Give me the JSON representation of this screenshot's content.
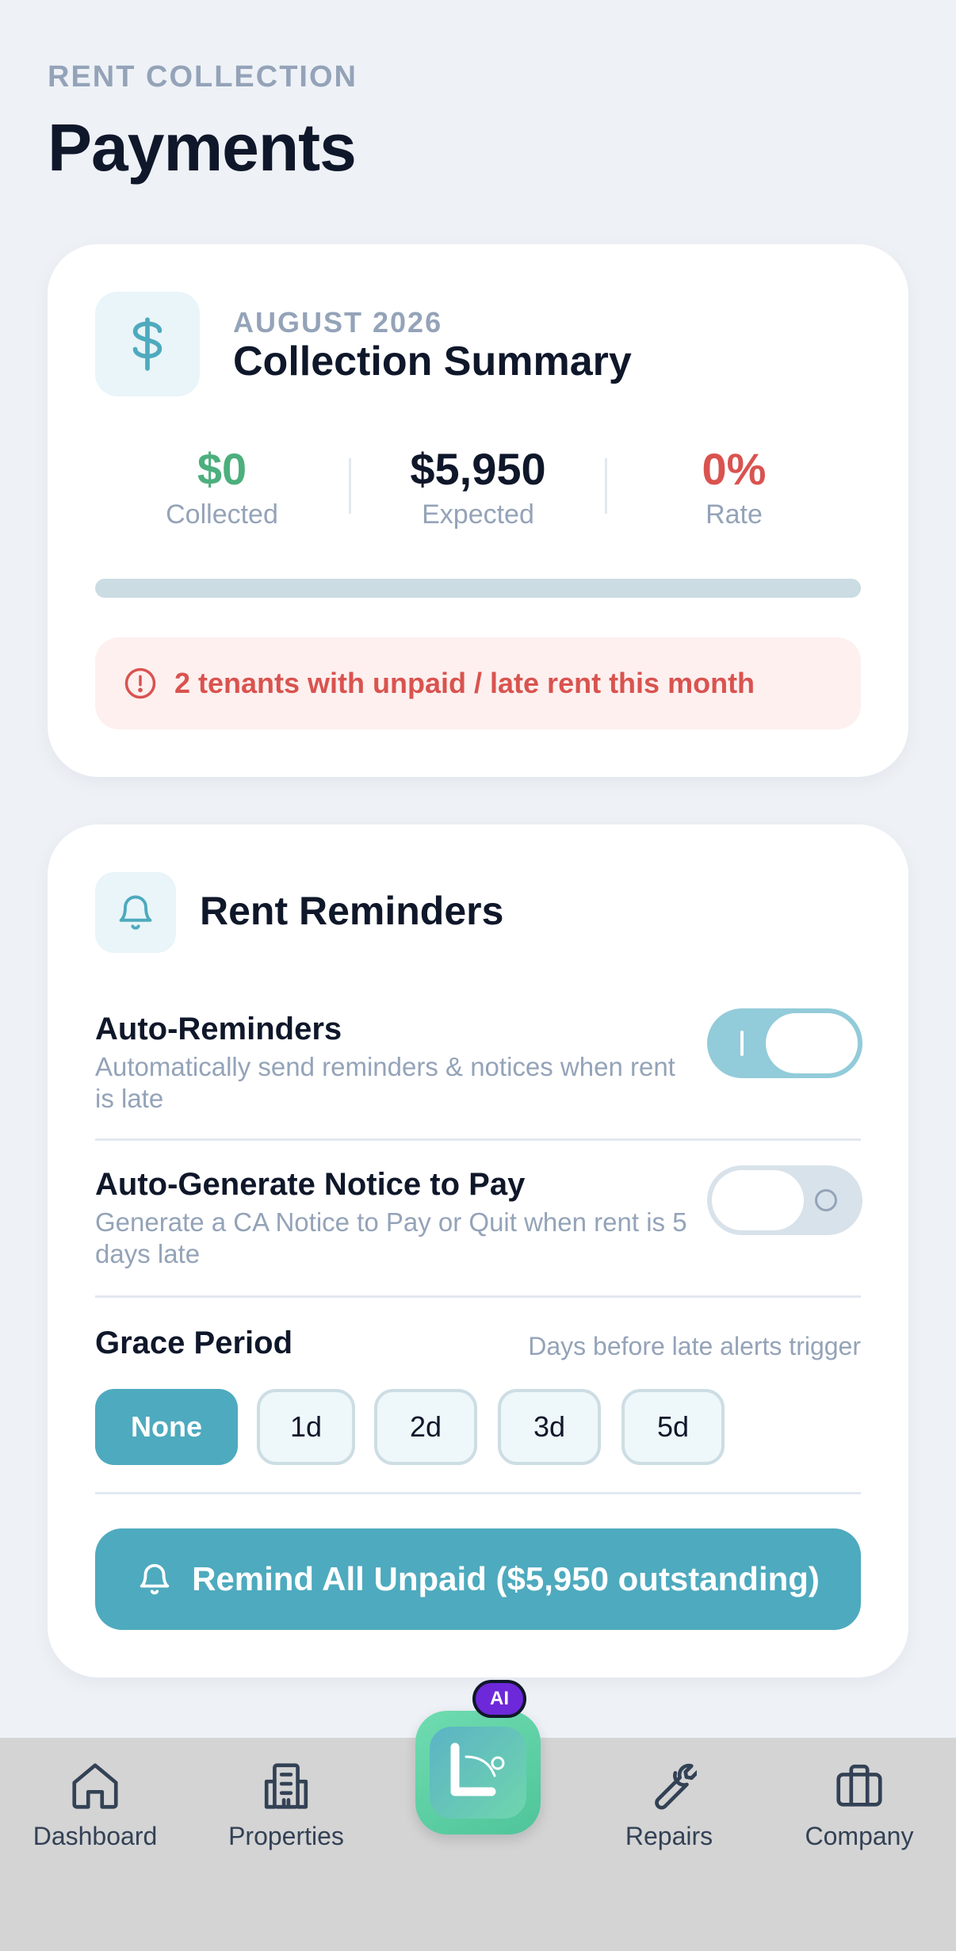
{
  "header": {
    "eyebrow": "RENT COLLECTION",
    "title": "Payments"
  },
  "summary": {
    "icon": "dollar-icon",
    "period": "AUGUST 2026",
    "title": "Collection Summary",
    "stats": [
      {
        "value": "$0",
        "label": "Collected",
        "color": "#4caf7d"
      },
      {
        "value": "$5,950",
        "label": "Expected",
        "color": "#0f172a"
      },
      {
        "value": "0%",
        "label": "Rate",
        "color": "#d9534f"
      }
    ],
    "collection_progress_percent": 0,
    "alert": {
      "icon": "alert-circle-icon",
      "text": "2 tenants with unpaid / late rent this month"
    }
  },
  "reminders": {
    "icon": "bell-icon",
    "title": "Rent Reminders",
    "auto_reminders": {
      "title": "Auto-Reminders",
      "description": "Automatically send reminders & notices when rent is late",
      "enabled": true
    },
    "auto_notice": {
      "title": "Auto-Generate Notice to Pay",
      "description": "Generate a CA Notice to Pay or Quit when rent is 5 days late",
      "enabled": false
    },
    "grace_period": {
      "title": "Grace Period",
      "hint": "Days before late alerts trigger",
      "options": [
        "None",
        "1d",
        "2d",
        "3d",
        "5d"
      ],
      "selected": "None"
    },
    "cta": {
      "icon": "bell-icon",
      "label": "Remind All Unpaid ($5,950 outstanding)"
    }
  },
  "nav": {
    "items": [
      {
        "label": "Dashboard",
        "icon": "home-icon"
      },
      {
        "label": "Properties",
        "icon": "building-icon"
      },
      {
        "label": "Repairs",
        "icon": "wrench-icon"
      },
      {
        "label": "Company",
        "icon": "briefcase-icon"
      }
    ],
    "center_badge": "AI",
    "center_icon": "app-logo-icon"
  },
  "colors": {
    "accent": "#4eaabe",
    "danger": "#d9534f",
    "success": "#4caf7d",
    "ai_badge": "#6d28d9"
  }
}
